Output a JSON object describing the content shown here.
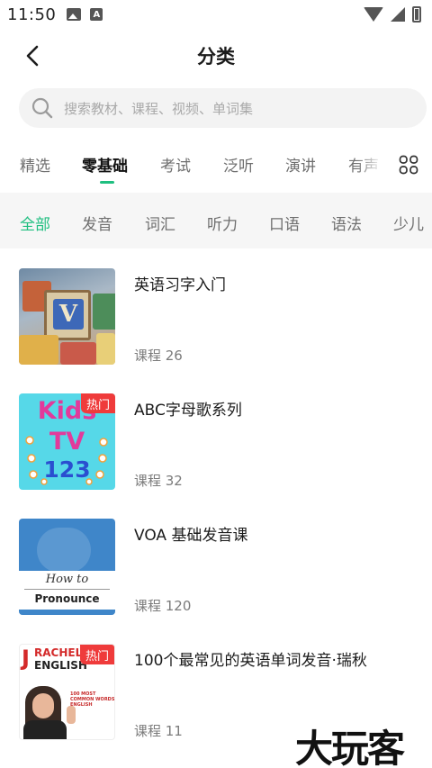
{
  "status_bar": {
    "time": "11:50"
  },
  "header": {
    "title": "分类"
  },
  "search": {
    "placeholder": "搜索教材、课程、视频、单词集"
  },
  "main_tabs": [
    {
      "label": "精选"
    },
    {
      "label": "零基础"
    },
    {
      "label": "考试"
    },
    {
      "label": "泛听"
    },
    {
      "label": "演讲"
    },
    {
      "label": "有声"
    }
  ],
  "active_main_tab": "零基础",
  "sub_tabs": [
    {
      "label": "全部"
    },
    {
      "label": "发音"
    },
    {
      "label": "词汇"
    },
    {
      "label": "听力"
    },
    {
      "label": "口语"
    },
    {
      "label": "语法"
    },
    {
      "label": "少儿"
    }
  ],
  "active_sub_tab": "全部",
  "courses": [
    {
      "name": "英语习字入门",
      "count": "课程 26",
      "badge": ""
    },
    {
      "name": "ABC字母歌系列",
      "count": "课程 32",
      "badge": "热门",
      "thumb_text": [
        "Kids",
        "TV",
        "123"
      ]
    },
    {
      "name": "VOA 基础发音课",
      "count": "课程 120",
      "badge": "",
      "thumb_text": [
        "How to",
        "Pronounce"
      ]
    },
    {
      "name": "100个最常见的英语单词发音·瑞秋",
      "count": "课程 11",
      "badge": "热门",
      "thumb_text": [
        "RACHEL'S",
        "ENGLISH",
        "100 MOST COMMON WORDS ENGLISH"
      ]
    }
  ],
  "watermark": "大玩客",
  "colors": {
    "accent": "#1fbf80",
    "hot_badge": "#ef3b3b"
  }
}
